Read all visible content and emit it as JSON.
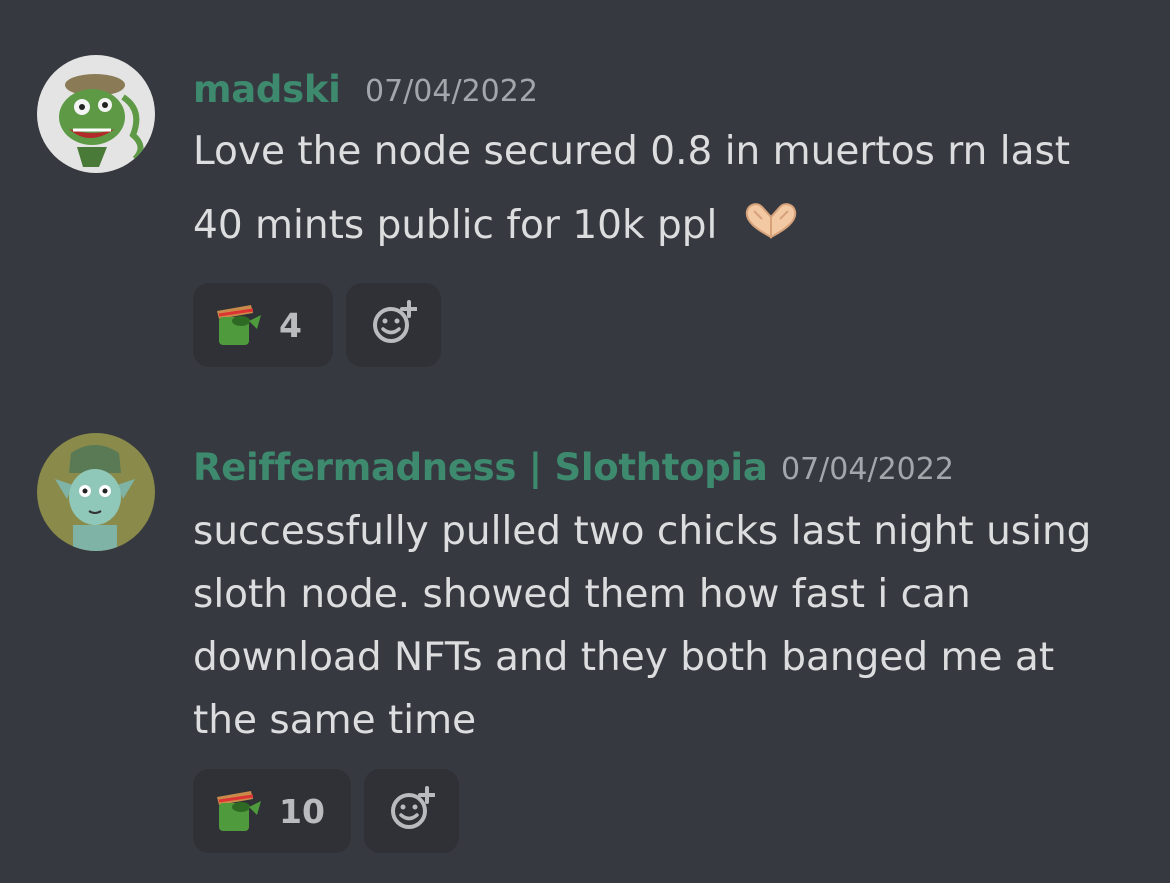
{
  "messages": [
    {
      "author": "madski",
      "timestamp": "07/04/2022",
      "lines": [
        "Love the node secured 0.8 in muertos rn last",
        "40 mints public for 10k ppl"
      ],
      "inline_emoji": "heart-hands-emoji",
      "reaction": {
        "emoji": "pepe-cowboy-emoji",
        "count": "4"
      },
      "add_reaction_icon": "add-reaction-icon"
    },
    {
      "author": "Reiffermadness | Slothtopia",
      "timestamp": "07/04/2022",
      "lines": [
        "successfully pulled two chicks last night using",
        "sloth node. showed them how fast i can",
        "download NFTs and they both banged me at",
        "the same time"
      ],
      "reaction": {
        "emoji": "pepe-cowboy-emoji",
        "count": "10"
      },
      "add_reaction_icon": "add-reaction-icon"
    }
  ],
  "colors": {
    "background": "#36393f",
    "username": "#3e8a6f",
    "text": "#dcddde",
    "timestamp": "#a3a6aa",
    "reaction_bg": "#2f3136"
  }
}
